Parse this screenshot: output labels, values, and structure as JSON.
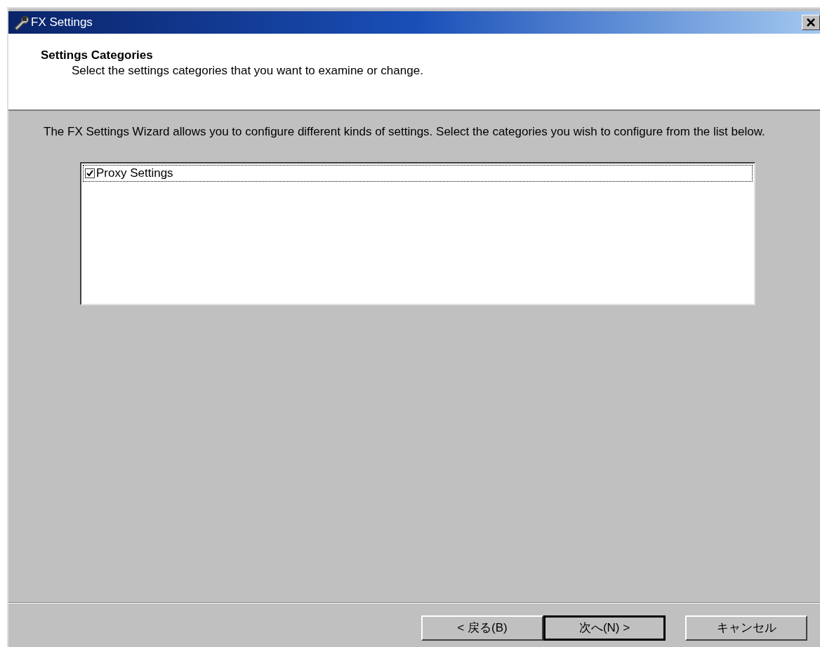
{
  "window": {
    "title": "FX Settings"
  },
  "header": {
    "title": "Settings Categories",
    "subtitle": "Select the settings categories that you want to examine or change."
  },
  "description": "The FX Settings Wizard allows you to configure different kinds of settings. Select the categories you wish to configure from the list below.",
  "categories": [
    {
      "label": "Proxy Settings",
      "checked": true,
      "selected": true
    }
  ],
  "buttons": [
    {
      "label": "< 戻る(B)",
      "default": false
    },
    {
      "label": "次へ(N) >",
      "default": true
    },
    {
      "label": "キャンセル",
      "default": false
    }
  ]
}
